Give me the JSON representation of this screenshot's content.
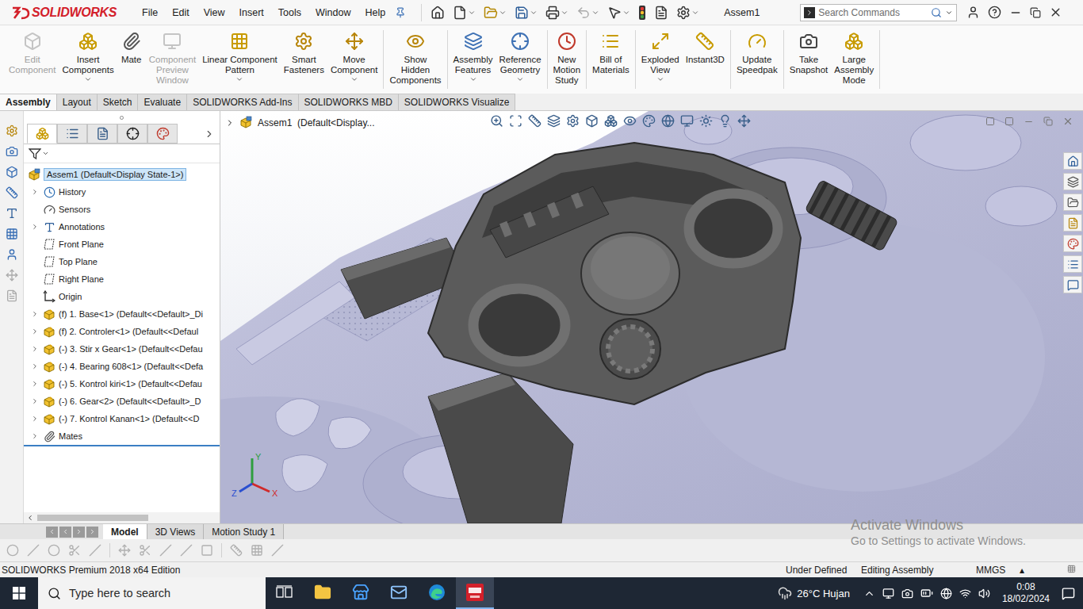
{
  "app": {
    "logo": "SOLIDWORKS",
    "title": "Assem1"
  },
  "menu": [
    "File",
    "Edit",
    "View",
    "Insert",
    "Tools",
    "Window",
    "Help"
  ],
  "search": {
    "placeholder": "Search Commands"
  },
  "ribbon": [
    [
      {
        "lines": [
          "Edit",
          "Component"
        ],
        "disabled": true,
        "dropdown": false
      },
      {
        "lines": [
          "Insert",
          "Components"
        ],
        "disabled": false,
        "dropdown": true
      },
      {
        "lines": [
          "Mate"
        ],
        "disabled": false,
        "dropdown": false
      },
      {
        "lines": [
          "Component",
          "Preview",
          "Window"
        ],
        "disabled": true,
        "dropdown": false
      },
      {
        "lines": [
          "Linear Component",
          "Pattern"
        ],
        "disabled": false,
        "dropdown": true
      },
      {
        "lines": [
          "Smart",
          "Fasteners"
        ],
        "disabled": false,
        "dropdown": false
      },
      {
        "lines": [
          "Move",
          "Component"
        ],
        "disabled": false,
        "dropdown": true
      }
    ],
    [
      {
        "lines": [
          "Show",
          "Hidden",
          "Components"
        ],
        "disabled": false,
        "dropdown": false
      }
    ],
    [
      {
        "lines": [
          "Assembly",
          "Features"
        ],
        "disabled": false,
        "dropdown": true
      },
      {
        "lines": [
          "Reference",
          "Geometry"
        ],
        "disabled": false,
        "dropdown": true
      }
    ],
    [
      {
        "lines": [
          "New",
          "Motion",
          "Study"
        ],
        "disabled": false,
        "dropdown": false
      }
    ],
    [
      {
        "lines": [
          "Bill of",
          "Materials"
        ],
        "disabled": false,
        "dropdown": false
      }
    ],
    [
      {
        "lines": [
          "Exploded",
          "View"
        ],
        "disabled": false,
        "dropdown": true
      },
      {
        "lines": [
          "Instant3D"
        ],
        "disabled": false,
        "dropdown": false
      }
    ],
    [
      {
        "lines": [
          "Update",
          "Speedpak"
        ],
        "disabled": false,
        "dropdown": false
      }
    ],
    [
      {
        "lines": [
          "Take",
          "Snapshot"
        ],
        "disabled": false,
        "dropdown": false
      },
      {
        "lines": [
          "Large",
          "Assembly",
          "Mode"
        ],
        "disabled": false,
        "dropdown": false
      }
    ]
  ],
  "ribbon_tabs": [
    {
      "label": "Assembly",
      "selected": true
    },
    {
      "label": "Layout",
      "selected": false
    },
    {
      "label": "Sketch",
      "selected": false
    },
    {
      "label": "Evaluate",
      "selected": false
    },
    {
      "label": "SOLIDWORKS Add-Ins",
      "selected": false
    },
    {
      "label": "SOLIDWORKS MBD",
      "selected": false
    },
    {
      "label": "SOLIDWORKS Visualize",
      "selected": false
    }
  ],
  "panel_tabs": [
    {
      "kind": "features",
      "selected": true
    },
    {
      "kind": "properties",
      "selected": false
    },
    {
      "kind": "configurations",
      "selected": false
    },
    {
      "kind": "dimxpert",
      "selected": false
    },
    {
      "kind": "display",
      "selected": false
    }
  ],
  "tree": {
    "root": {
      "label": "Assem1 (Default<Display State-1>)",
      "selected": true
    },
    "items": [
      {
        "label": "History",
        "kind": "history",
        "collapsible": true
      },
      {
        "label": "Sensors",
        "kind": "sensors",
        "collapsible": false
      },
      {
        "label": "Annotations",
        "kind": "annotations",
        "collapsible": true
      },
      {
        "label": "Front Plane",
        "kind": "plane",
        "collapsible": false
      },
      {
        "label": "Top Plane",
        "kind": "plane",
        "collapsible": false
      },
      {
        "label": "Right Plane",
        "kind": "plane",
        "collapsible": false
      },
      {
        "label": "Origin",
        "kind": "origin",
        "collapsible": false
      },
      {
        "label": "(f) 1. Base<1> (Default<<Default>_Di",
        "kind": "part",
        "collapsible": true
      },
      {
        "label": "(f) 2. Controler<1> (Default<<Defaul",
        "kind": "part",
        "collapsible": true
      },
      {
        "label": "(-) 3. Stir x Gear<1> (Default<<Defau",
        "kind": "part",
        "collapsible": true
      },
      {
        "label": "(-) 4. Bearing 608<1> (Default<<Defa",
        "kind": "part",
        "collapsible": true
      },
      {
        "label": "(-) 5. Kontrol kiri<1> (Default<<Defau",
        "kind": "part",
        "collapsible": true
      },
      {
        "label": "(-) 6. Gear<2> (Default<<Default>_D",
        "kind": "part",
        "collapsible": true
      },
      {
        "label": "(-) 7. Kontrol Kanan<1> (Default<<D",
        "kind": "part",
        "collapsible": true
      },
      {
        "label": "Mates",
        "kind": "mates",
        "collapsible": true
      }
    ]
  },
  "viewport": {
    "breadcrumb": "Assem1  (Default<Display...",
    "triad": {
      "x": "X",
      "y": "Y",
      "z": "Z"
    }
  },
  "watermark": {
    "title": "Activate Windows",
    "subtitle": "Go to Settings to activate Windows."
  },
  "bottom_tabs": [
    {
      "label": "Model",
      "selected": true
    },
    {
      "label": "3D Views",
      "selected": false
    },
    {
      "label": "Motion Study 1",
      "selected": false
    }
  ],
  "status_bar": {
    "edition": "SOLIDWORKS Premium 2018 x64 Edition",
    "state": "Under Defined",
    "mode": "Editing Assembly",
    "units": "MMGS",
    "units_arrow": "▴"
  },
  "taskbar": {
    "search_placeholder": "Type here to search",
    "apps": [
      {
        "kind": "taskview",
        "active": false
      },
      {
        "kind": "explorer",
        "active": false
      },
      {
        "kind": "store",
        "active": false
      },
      {
        "kind": "mail",
        "active": false
      },
      {
        "kind": "edge",
        "active": false
      },
      {
        "kind": "solidworks",
        "active": true
      }
    ],
    "weather": "26°C Hujan",
    "time": "0:08",
    "date": "18/02/2024"
  }
}
